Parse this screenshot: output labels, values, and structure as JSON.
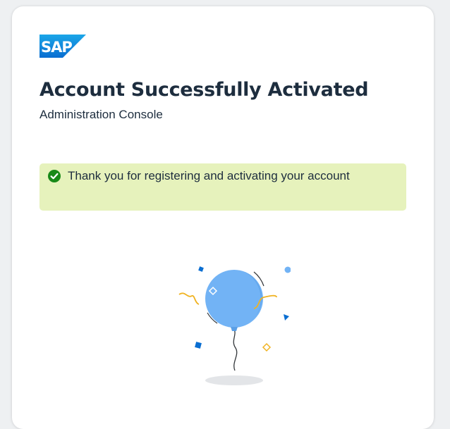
{
  "logo": {
    "text": "SAP",
    "color": "#0a6ed1"
  },
  "header": {
    "title": "Account Successfully Activated",
    "subtitle": "Administration Console"
  },
  "message": {
    "type": "success",
    "icon": "check-circle-icon",
    "text": "Thank you for registering and activating your account",
    "background": "#e6f2bc",
    "icon_color": "#188918"
  },
  "illustration": {
    "name": "balloon-celebration-illustration",
    "balloon_color": "#72b3f5",
    "confetti_colors": [
      "#0a6ed1",
      "#f0b322"
    ]
  }
}
